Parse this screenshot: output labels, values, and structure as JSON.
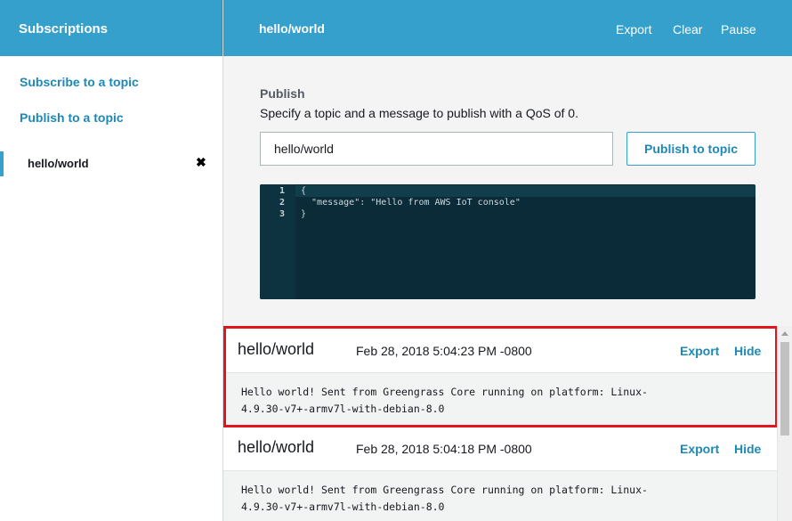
{
  "sidebar": {
    "title": "Subscriptions",
    "subscribe_link": "Subscribe to a topic",
    "publish_link": "Publish to a topic",
    "subscription": {
      "label": "hello/world",
      "close": "✖"
    }
  },
  "header": {
    "topic": "hello/world",
    "export": "Export",
    "clear": "Clear",
    "pause": "Pause"
  },
  "publish": {
    "title": "Publish",
    "description": "Specify a topic and a message to publish with a QoS of 0.",
    "topic_value": "hello/world",
    "button": "Publish to topic",
    "editor": {
      "line_numbers": [
        "1",
        "2",
        "3"
      ],
      "lines": [
        "{",
        "  \"message\": \"Hello from AWS IoT console\"",
        "}"
      ]
    }
  },
  "messages": [
    {
      "topic": "hello/world",
      "timestamp": "Feb 28, 2018 5:04:23 PM -0800",
      "export": "Export",
      "hide": "Hide",
      "payload_line1": "Hello world! Sent from Greengrass Core running on platform: Linux-",
      "payload_line2": "4.9.30-v7+-armv7l-with-debian-8.0"
    },
    {
      "topic": "hello/world",
      "timestamp": "Feb 28, 2018 5:04:18 PM -0800",
      "export": "Export",
      "hide": "Hide",
      "payload_line1": "Hello world! Sent from Greengrass Core running on platform: Linux-",
      "payload_line2": "4.9.30-v7+-armv7l-with-debian-8.0"
    }
  ],
  "colors": {
    "accent": "#35a0cb",
    "link": "#1e89b6",
    "editor_bg": "#0a2b37",
    "highlight_box": "#e2151f"
  }
}
